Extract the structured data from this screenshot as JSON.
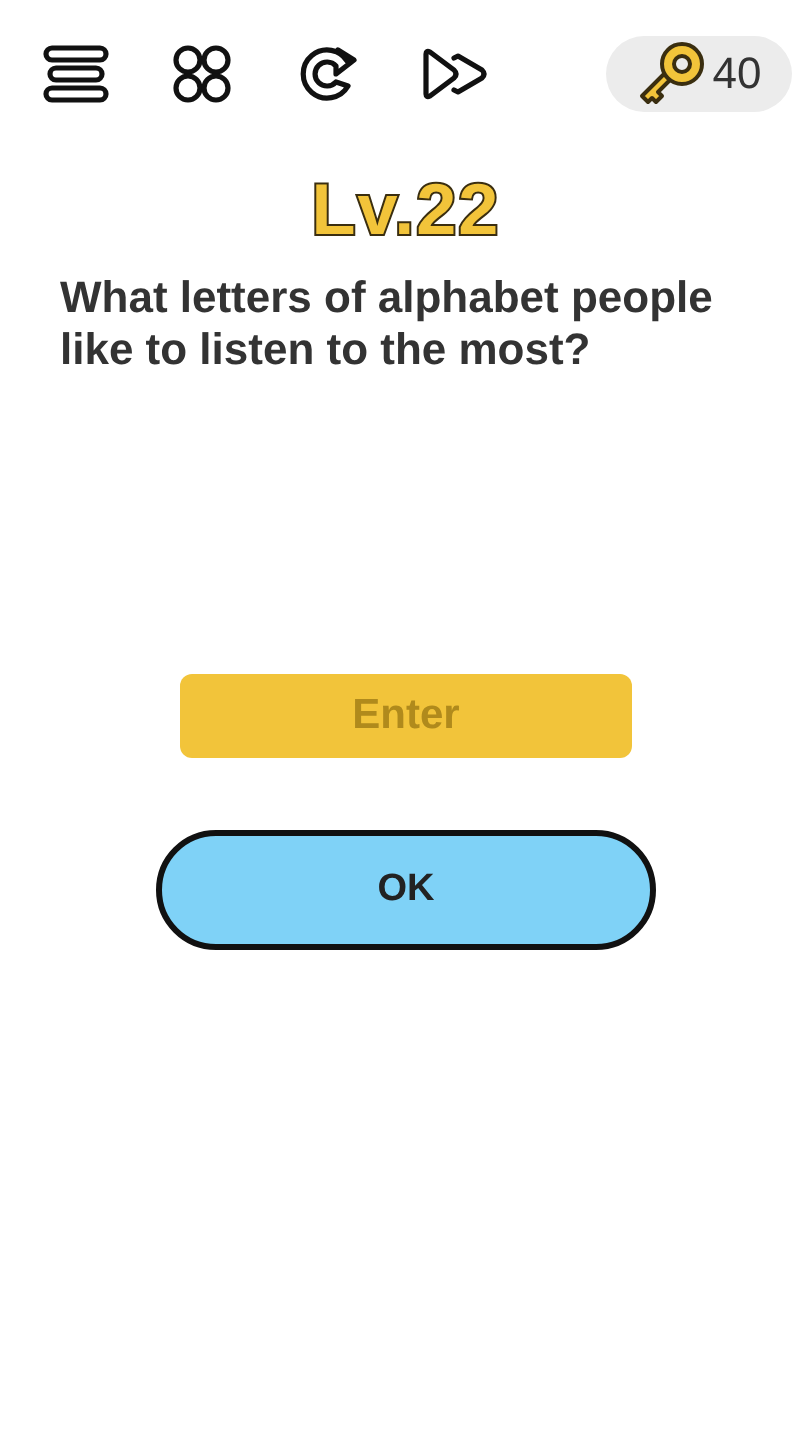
{
  "toolbar": {
    "keys": "40"
  },
  "level": "Lv.22",
  "question": "What letters of alphabet people like to listen to the most?",
  "answer": {
    "placeholder": "Enter"
  },
  "submit": "OK"
}
